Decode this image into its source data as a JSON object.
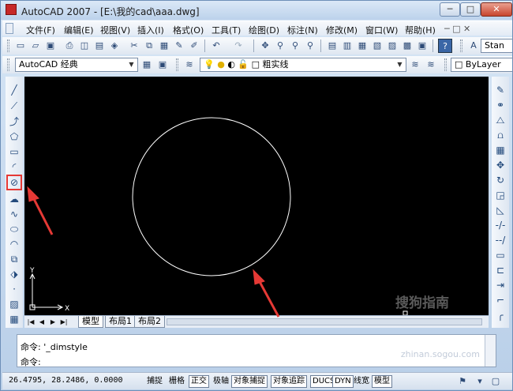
{
  "window": {
    "title": "AutoCAD 2007 - [E:\\我的cad\\aaa.dwg]",
    "min": "─",
    "max": "□",
    "close": "✕"
  },
  "menu": [
    "文件(F)",
    "编辑(E)",
    "视图(V)",
    "插入(I)",
    "格式(O)",
    "工具(T)",
    "绘图(D)",
    "标注(N)",
    "修改(M)",
    "窗口(W)",
    "帮助(H)"
  ],
  "toolbar": {
    "text_style": "Stan",
    "workspace": "AutoCAD 经典",
    "layer": "粗实线",
    "color": "ByLayer"
  },
  "layout_tabs": [
    "模型",
    "布局1",
    "布局2"
  ],
  "axis": {
    "x": "X",
    "y": "Y"
  },
  "command": {
    "history": "命令: '_dimstyle",
    "prompt": "命令:"
  },
  "status": {
    "coords": "26.4795, 28.2486, 0.0000",
    "buttons": [
      "捕捉",
      "栅格",
      "正交",
      "极轴",
      "对象捕捉",
      "对象追踪",
      "DUCS",
      "DYN",
      "线宽",
      "模型"
    ],
    "active": [
      "正交",
      "对象捕捉",
      "对象追踪",
      "DUCS",
      "DYN",
      "模型"
    ]
  },
  "icons": {
    "left_tools": [
      "line-icon",
      "construction-line-icon",
      "polyline-icon",
      "polygon-icon",
      "rectangle-icon",
      "arc-icon",
      "circle-icon",
      "revision-cloud-icon",
      "spline-icon",
      "ellipse-icon",
      "ellipse-arc-icon",
      "insert-block-icon",
      "make-block-icon",
      "point-icon",
      "hatch-icon",
      "region-icon"
    ],
    "right_tools": [
      "erase-icon",
      "copy-icon",
      "mirror-icon",
      "offset-icon",
      "array-icon",
      "move-icon",
      "rotate-icon",
      "scale-icon",
      "stretch-icon",
      "trim-icon",
      "extend-icon",
      "break-point-icon",
      "break-icon",
      "join-icon",
      "chamfer-icon",
      "fillet-icon",
      "explode-icon"
    ]
  },
  "watermark": {
    "brand": "搜狗指南",
    "url": "zhinan.sogou.com"
  },
  "colors": {
    "highlight": "#e53935",
    "canvas": "#000000"
  }
}
